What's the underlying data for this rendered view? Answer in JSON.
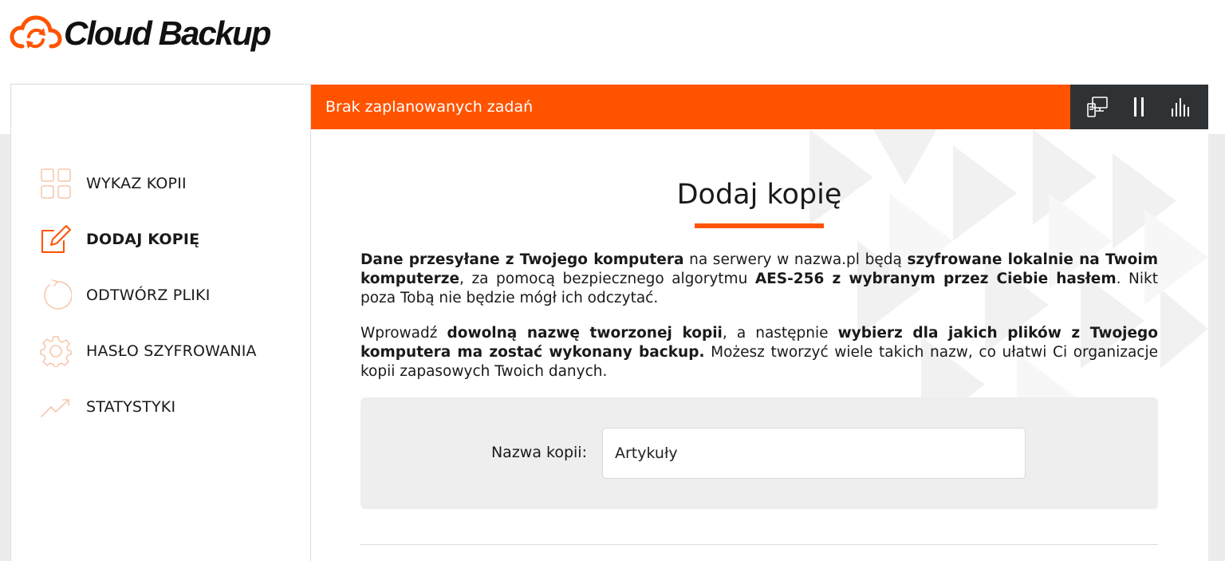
{
  "app": {
    "logo_text": "Cloud Backup",
    "brand_color": "#ff5300",
    "dark_color": "#2f3235"
  },
  "sidebar": {
    "items": [
      {
        "label": "WYKAZ KOPII",
        "icon": "grid-icon",
        "active": false
      },
      {
        "label": "DODAJ KOPIĘ",
        "icon": "edit-icon",
        "active": true
      },
      {
        "label": "ODTWÓRZ PLIKI",
        "icon": "restore-icon",
        "active": false
      },
      {
        "label": "HASŁO SZYFROWANIA",
        "icon": "gear-icon",
        "active": false
      },
      {
        "label": "STATYSTYKI",
        "icon": "chart-line-icon",
        "active": false
      }
    ]
  },
  "topbar": {
    "status": "Brak zaplanowanych zadań",
    "tools": [
      "computer-icon",
      "pause-icon",
      "bar-chart-icon"
    ]
  },
  "main": {
    "title": "Dodaj kopię",
    "para1": [
      {
        "text": "Dane przesyłane z Twojego komputera",
        "bold": true
      },
      {
        "text": " na serwery w nazwa.pl będą ",
        "bold": false
      },
      {
        "text": "szyfrowane lokalnie na Twoim komputerze",
        "bold": true
      },
      {
        "text": ", za pomocą bezpiecznego algorytmu ",
        "bold": false
      },
      {
        "text": "AES-256 z wybranym przez Ciebie hasłem",
        "bold": true
      },
      {
        "text": ". Nikt poza Tobą nie będzie mógł ich odczytać.",
        "bold": false
      }
    ],
    "para2": [
      {
        "text": "Wprowadź ",
        "bold": false
      },
      {
        "text": "dowolną nazwę tworzonej kopii",
        "bold": true
      },
      {
        "text": ", a następnie ",
        "bold": false
      },
      {
        "text": "wybierz dla jakich plików z Twojego komputera ma zostać wykonany backup.",
        "bold": true
      },
      {
        "text": " Możesz tworzyć wiele takich nazw, co ułatwi Ci organizacje kopii zapasowych Twoich danych.",
        "bold": false
      }
    ],
    "form": {
      "label": "Nazwa kopii:",
      "value": "Artykuły"
    }
  }
}
